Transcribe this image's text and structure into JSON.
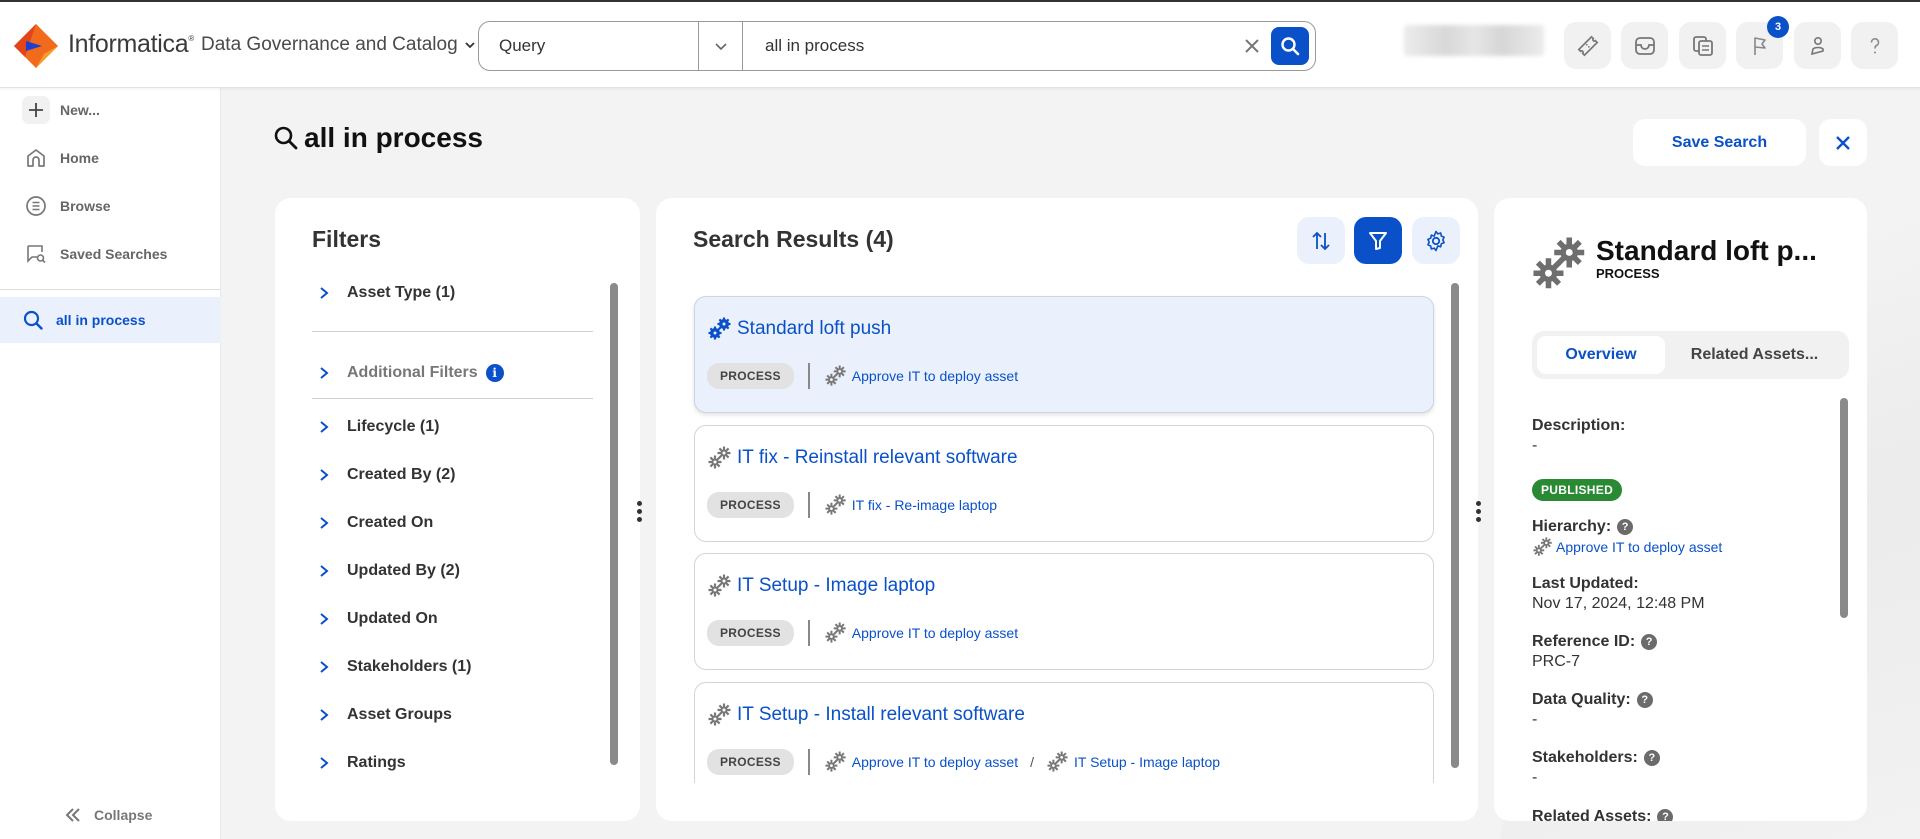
{
  "header": {
    "brand": "Informatica",
    "product": "Data Governance and Catalog",
    "search_type": "Query",
    "search_value": "all in process",
    "search_placeholder": "",
    "notification_count": "3",
    "icons": [
      "ticket-icon",
      "inbox-icon",
      "copy-document-icon",
      "flag-icon",
      "user-icon",
      "help-icon"
    ]
  },
  "sidebar": {
    "items": [
      {
        "label": "New...",
        "icon": "plus-icon"
      },
      {
        "label": "Home",
        "icon": "home-icon"
      },
      {
        "label": "Browse",
        "icon": "browse-list-icon"
      },
      {
        "label": "Saved Searches",
        "icon": "saved-search-icon"
      }
    ],
    "active_search": "all in process",
    "collapse_label": "Collapse"
  },
  "page": {
    "title": "all in process",
    "save_search_label": "Save Search"
  },
  "filters": {
    "title": "Filters",
    "items": [
      {
        "label": "Asset Type (1)"
      },
      {
        "label": "Additional Filters"
      },
      {
        "label": "Lifecycle (1)"
      },
      {
        "label": "Created By (2)"
      },
      {
        "label": "Created On"
      },
      {
        "label": "Updated By (2)"
      },
      {
        "label": "Updated On"
      },
      {
        "label": "Stakeholders (1)"
      },
      {
        "label": "Asset Groups"
      },
      {
        "label": "Ratings"
      }
    ]
  },
  "results": {
    "title": "Search Results (4)",
    "items": [
      {
        "title": "Standard loft push",
        "type": "PROCESS",
        "path": [
          "Approve IT to deploy asset"
        ],
        "selected": true
      },
      {
        "title": "IT fix - Reinstall relevant software",
        "type": "PROCESS",
        "path": [
          "IT fix - Re-image laptop"
        ]
      },
      {
        "title": "IT Setup - Image laptop",
        "type": "PROCESS",
        "path": [
          "Approve IT to deploy asset"
        ]
      },
      {
        "title": "IT Setup - Install relevant software",
        "type": "PROCESS",
        "path": [
          "Approve IT to deploy asset",
          "IT Setup - Image laptop"
        ]
      }
    ],
    "path_separator": "/"
  },
  "detail": {
    "title": "Standard loft p...",
    "type": "PROCESS",
    "tabs": [
      "Overview",
      "Related Assets..."
    ],
    "description_label": "Description:",
    "description_value": "-",
    "status": "PUBLISHED",
    "hierarchy_label": "Hierarchy:",
    "hierarchy_value": "Approve IT to deploy asset",
    "last_updated_label": "Last Updated:",
    "last_updated_value": "Nov 17, 2024, 12:48 PM",
    "reference_id_label": "Reference ID:",
    "reference_id_value": "PRC-7",
    "data_quality_label": "Data Quality:",
    "data_quality_value": "-",
    "stakeholders_label": "Stakeholders:",
    "stakeholders_value": "-",
    "related_assets_label": "Related Assets:",
    "help_glyph": "?"
  },
  "colors": {
    "accent": "#0a51c9",
    "selected_bg": "#ebf1fc",
    "published": "#2a8a34",
    "brand_orange": "#f26b1d"
  }
}
